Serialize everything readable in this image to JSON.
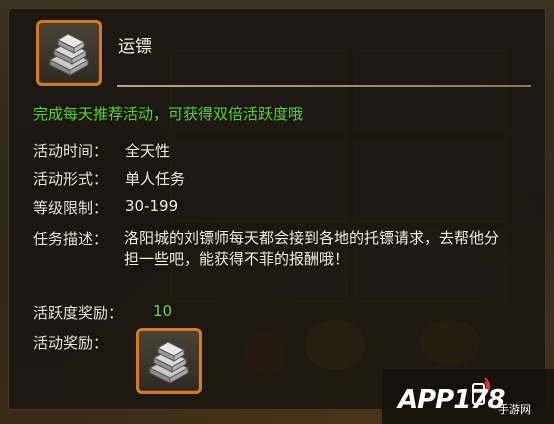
{
  "item": {
    "title": "运镖",
    "icon": "silver-ingot-icon",
    "promo": "完成每天推荐活动，可获得双倍活跃度哦"
  },
  "details": {
    "time_label": "活动时间：",
    "time_value": "全天性",
    "form_label": "活动形式：",
    "form_value": "单人任务",
    "level_label": "等级限制：",
    "level_value": "30-199",
    "desc_label": "任务描述：",
    "desc_text": "洛阳城的刘镖师每天都会接到各地的托镖请求，去帮他分担一些吧，能获得不菲的报酬哦！",
    "activity_label": "活跃度奖励：",
    "activity_value": "10",
    "reward_label": "活动奖励：",
    "reward_icon": "silver-ingot-icon"
  },
  "watermark": {
    "logo": "APP178",
    "sub": "手游网"
  },
  "colors": {
    "accent_frame": "#d07a2a",
    "green_text": "#52d42e",
    "panel_bg": "#16140f"
  }
}
